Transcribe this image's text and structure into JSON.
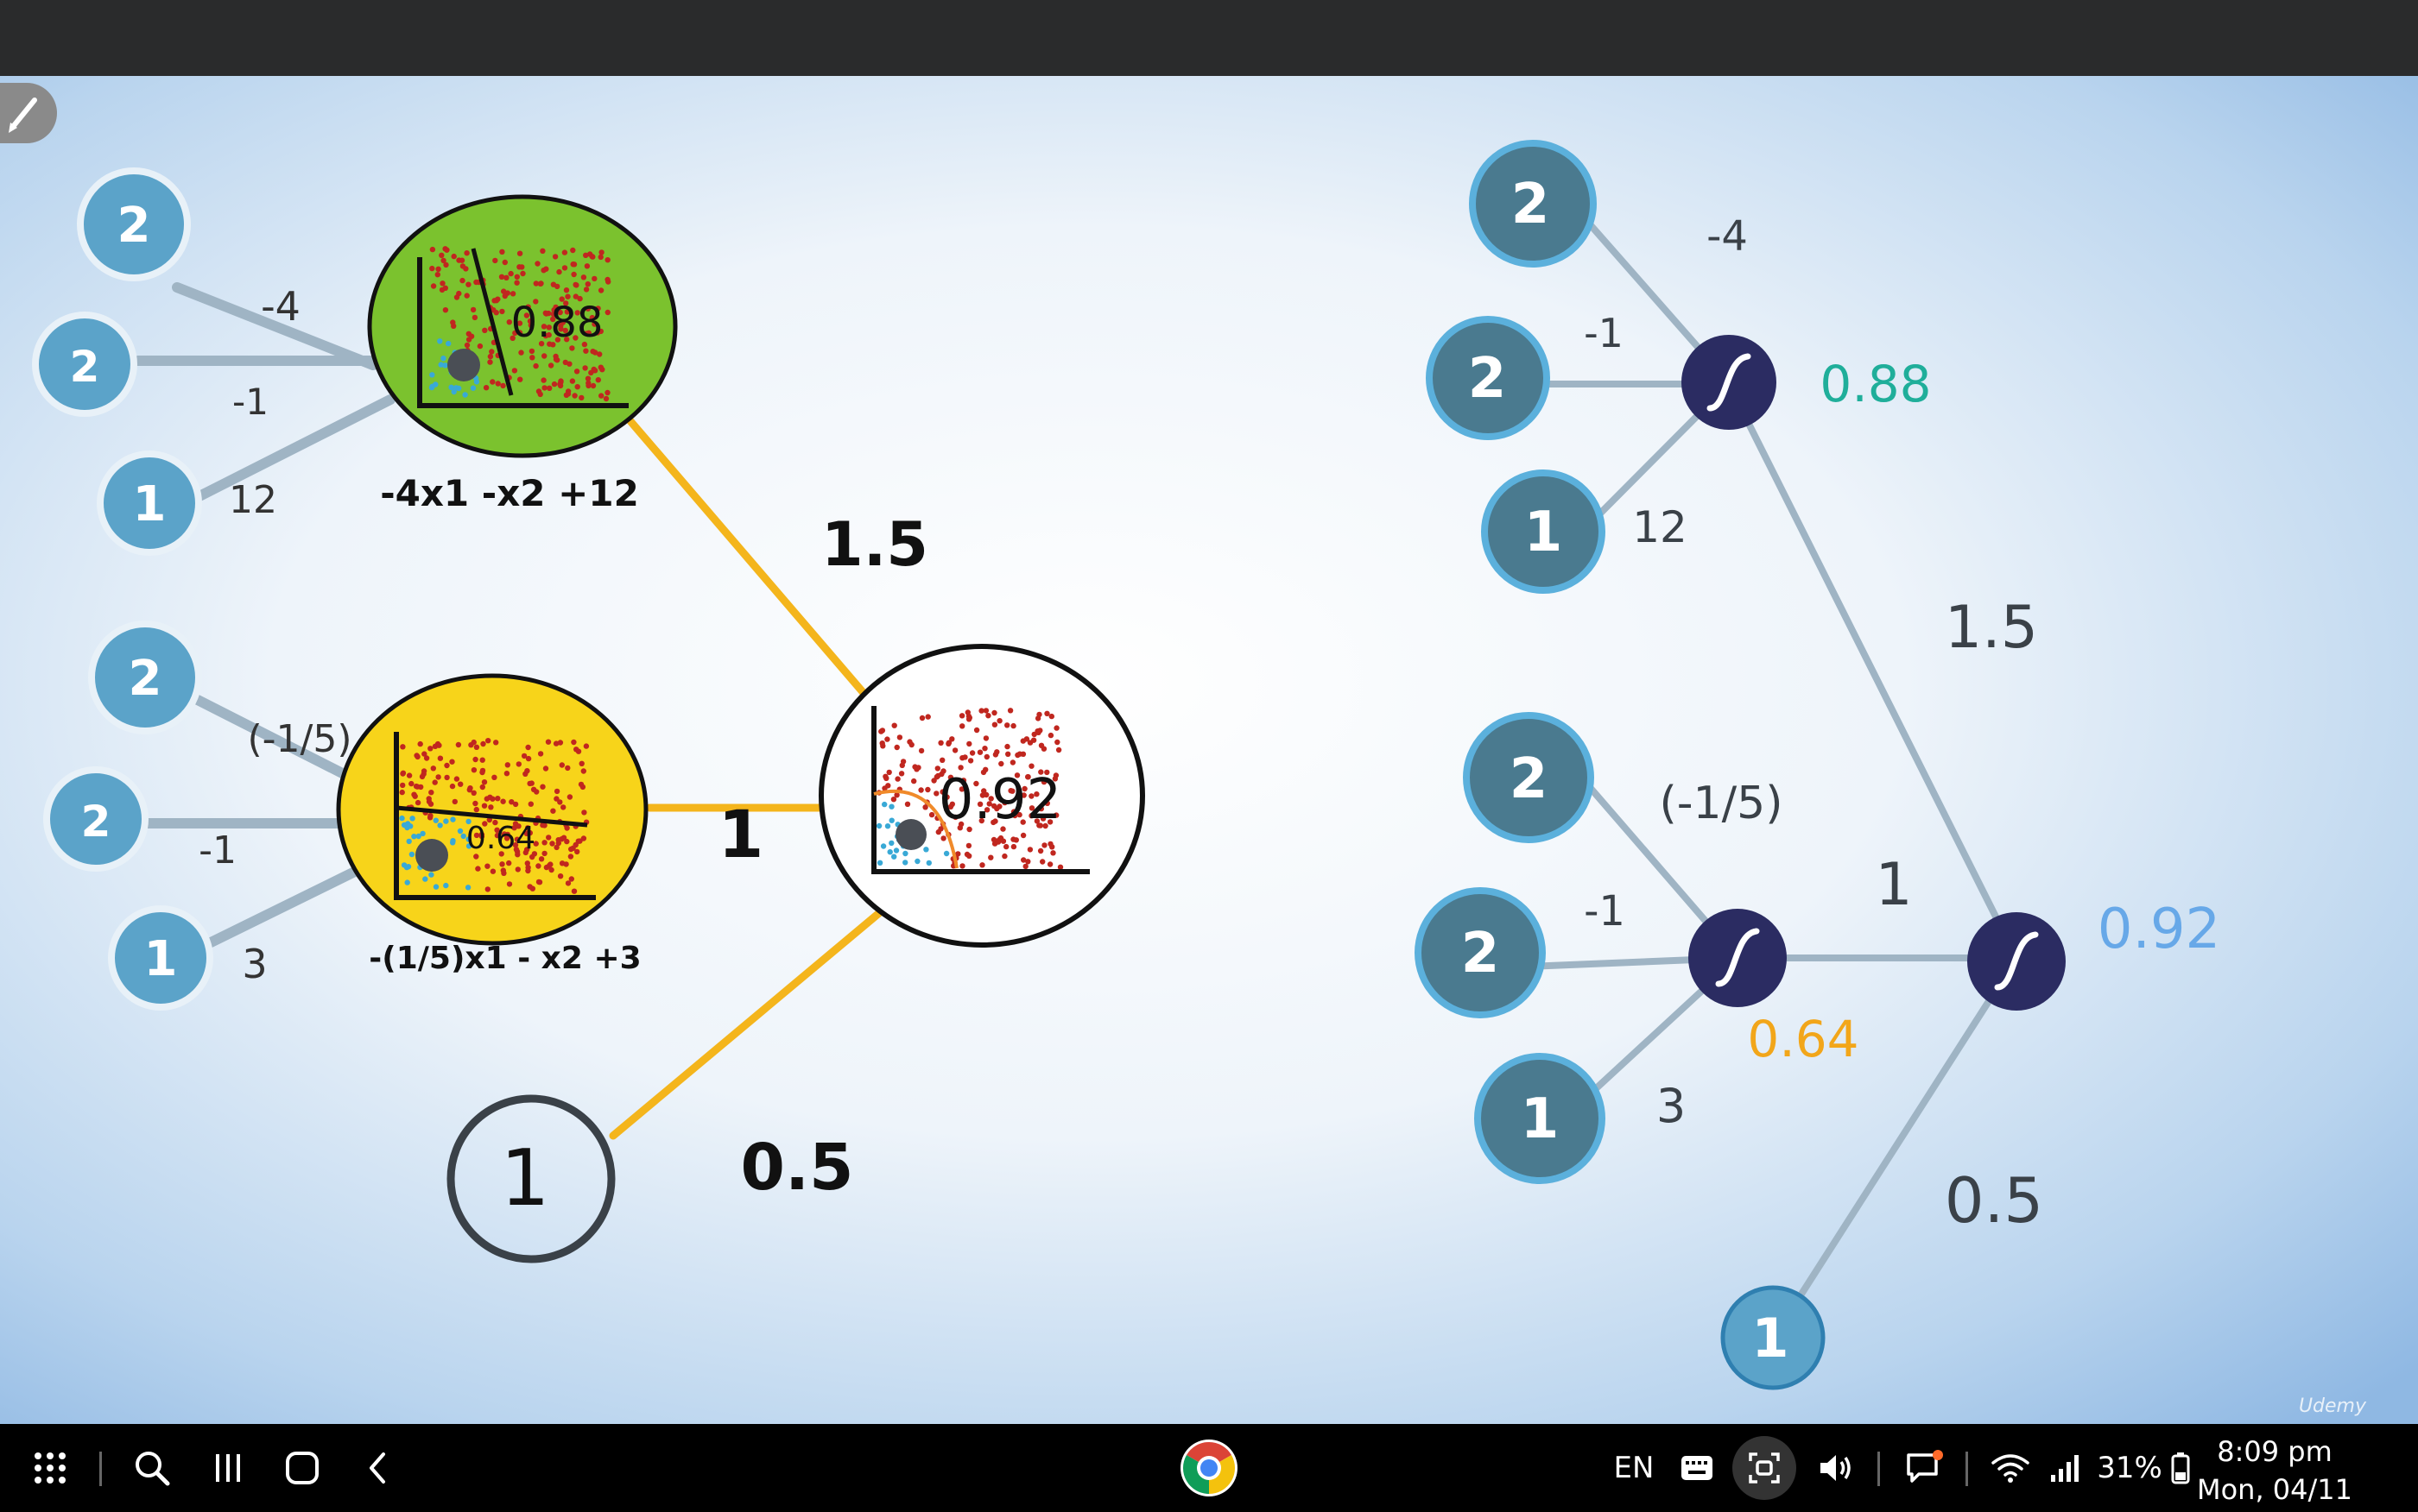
{
  "left_diagram": {
    "top_unit": {
      "inputs": [
        "2",
        "2",
        "1"
      ],
      "weights": [
        "-4",
        "-1",
        "12"
      ],
      "output": "0.88",
      "equation": "-4x1 -x2 +12"
    },
    "bottom_unit": {
      "inputs": [
        "2",
        "2",
        "1"
      ],
      "weights": [
        "(-1/5)",
        "-1",
        "3"
      ],
      "output": "0.64",
      "equation": "-(1/5)x1 - x2 +3"
    },
    "output_unit": {
      "output": "0.92"
    },
    "bias_node": "1",
    "edge_weights": {
      "top": "1.5",
      "middle": "1",
      "bias": "0.5"
    }
  },
  "right_diagram": {
    "top_unit": {
      "inputs": [
        "2",
        "2",
        "1"
      ],
      "weights": [
        "-4",
        "-1",
        "12"
      ],
      "output": "0.88"
    },
    "bottom_unit": {
      "inputs": [
        "2",
        "2",
        "1"
      ],
      "weights": [
        "(-1/5)",
        "-1",
        "3"
      ],
      "output": "0.64"
    },
    "output_unit": {
      "output": "0.92"
    },
    "bias_node": "1",
    "edge_weights": {
      "top": "1.5",
      "middle": "1",
      "bias": "0.5"
    }
  },
  "watermark": "Udemy",
  "colors": {
    "input_node_left": "#5ba3c9",
    "input_node_right": "#4a7a8f",
    "sigmoid_node": "#2b2c62",
    "top_output": "#1fae9a",
    "bottom_output": "#f2a61a",
    "final_output": "#67a8e8",
    "edge_orange": "#f4b51c",
    "edge_gray": "#9fb4c4",
    "top_perceptron_fill": "#7bc22e",
    "bottom_perceptron_fill": "#f7d41a"
  },
  "taskbar": {
    "icons": [
      "apps-grid-icon",
      "search-icon",
      "recents-icon",
      "home-icon",
      "back-icon",
      "chrome-icon"
    ],
    "language": "EN",
    "battery": "31%",
    "time": "8:09 pm",
    "date": "Mon, 04/11"
  }
}
